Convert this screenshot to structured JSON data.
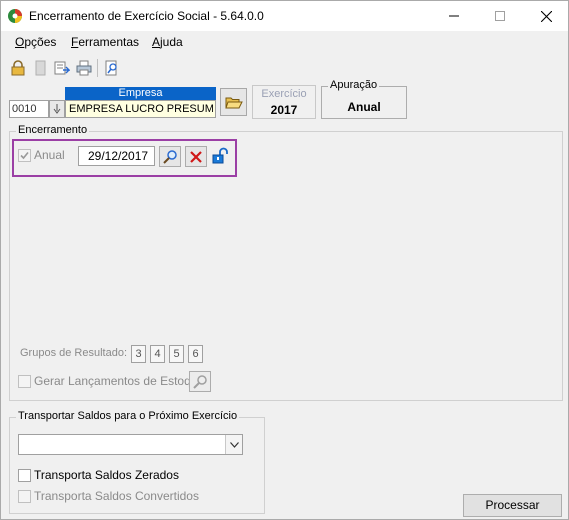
{
  "window": {
    "title": "Encerramento de Exercício Social - 5.64.0.0",
    "controls": {
      "minimize": "—",
      "maximize": "☐",
      "close": "✕"
    }
  },
  "menu": {
    "items": [
      {
        "first": "O",
        "rest": "pções"
      },
      {
        "first": "F",
        "rest": "erramentas"
      },
      {
        "first": "A",
        "rest": "juda"
      }
    ]
  },
  "toolbar": {
    "icons": [
      "lock-icon",
      "document-icon",
      "export-icon",
      "print-icon",
      "search-doc-icon"
    ]
  },
  "empresa": {
    "header": "Empresa",
    "code": "0010",
    "name": "EMPRESA LUCRO PRESUM"
  },
  "exercicio": {
    "label": "Exercício",
    "value": "2017"
  },
  "apuracao": {
    "label": "Apuração",
    "value": "Anual"
  },
  "encerramento": {
    "legend": "Encerramento",
    "anual_label": "Anual",
    "anual_checked": true,
    "date": "29/12/2017",
    "grupos_label": "Grupos de Resultado:",
    "grupos": [
      "3",
      "4",
      "5",
      "6"
    ],
    "gerar_label": "Gerar Lançamentos de Estoque"
  },
  "transportar": {
    "legend": "Transportar Saldos para o Próximo Exercício",
    "combo_value": "",
    "zerados_label": "Transporta Saldos Zerados",
    "convertidos_label": "Transporta Saldos Convertidos"
  },
  "actions": {
    "processar": "Processar"
  },
  "colors": {
    "accent": "#0a64c8",
    "highlight": "#9b3fa5",
    "delete": "#d01818"
  }
}
